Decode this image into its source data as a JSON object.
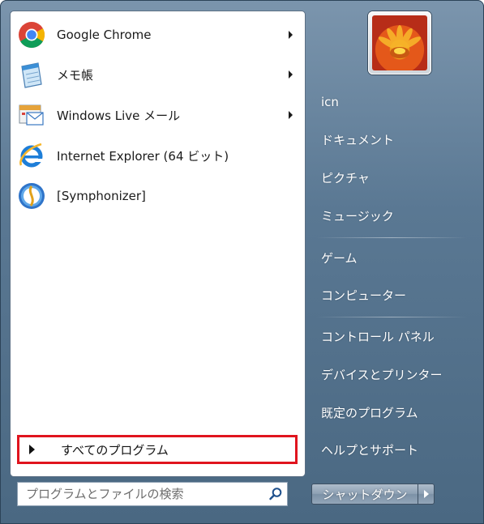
{
  "programs": [
    {
      "label": "Google Chrome",
      "icon": "chrome-icon",
      "has_submenu": true
    },
    {
      "label": "メモ帳",
      "icon": "notepad-icon",
      "has_submenu": true
    },
    {
      "label": "Windows Live メール",
      "icon": "windows-live-mail-icon",
      "has_submenu": true
    },
    {
      "label": "Internet Explorer (64 ビット)",
      "icon": "internet-explorer-icon",
      "has_submenu": false
    },
    {
      "label": "[Symphonizer]",
      "icon": "symphonizer-icon",
      "has_submenu": false
    }
  ],
  "all_programs": {
    "label": "すべてのプログラム",
    "highlight_color": "#e0141e"
  },
  "search": {
    "placeholder": "プログラムとファイルの検索",
    "icon": "search-icon"
  },
  "user": {
    "name": "icn",
    "avatar": "flower-avatar"
  },
  "right_items": {
    "documents": "ドキュメント",
    "pictures": "ピクチャ",
    "music": "ミュージック",
    "games": "ゲーム",
    "computer": "コンピューター",
    "control_panel": "コントロール パネル",
    "devices_printers": "デバイスとプリンター",
    "default_programs": "既定のプログラム",
    "help_support": "ヘルプとサポート"
  },
  "shutdown": {
    "label": "シャットダウン",
    "arrow_icon": "triangle-right-icon"
  },
  "colors": {
    "frame": "#5a7893",
    "left_pane": "#ffffff",
    "right_text": "#ffffff"
  }
}
